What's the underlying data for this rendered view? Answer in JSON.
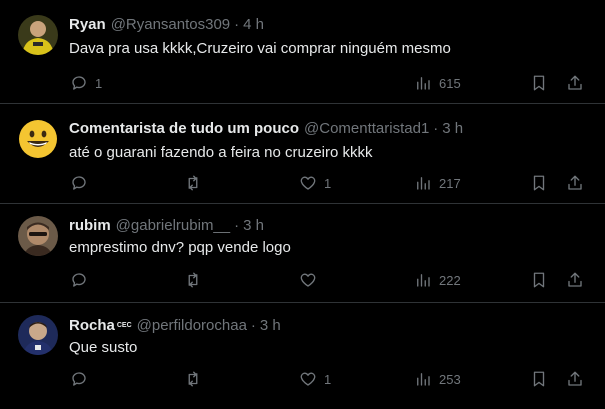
{
  "tweets": [
    {
      "name": "Ryan",
      "handle": "@Ryansantos309",
      "dot": "·",
      "time": "4 h",
      "text": "Dava pra usa kkkk,Cruzeiro vai comprar ninguém mesmo",
      "replies": "1",
      "retweets": "",
      "likes": "",
      "views": "615",
      "avatar_colors": [
        "#d8c21a",
        "#2a2a2a"
      ]
    },
    {
      "name": "Comentarista de tudo um pouco",
      "handle": "@Comenttaristad1",
      "dot": "·",
      "time": "3 h",
      "text": "até o guarani fazendo a feira no cruzeiro kkkk",
      "replies": "",
      "retweets": "",
      "likes": "1",
      "views": "217",
      "avatar_colors": [
        "#f4c531",
        "#3b2a12"
      ]
    },
    {
      "name": "rubim",
      "handle": "@gabrielrubim__",
      "dot": "·",
      "time": "3 h",
      "text": "emprestimo dnv? pqp vende logo",
      "replies": "",
      "retweets": "",
      "likes": "",
      "views": "222",
      "avatar_colors": [
        "#8a6a4f",
        "#3a2a20"
      ]
    },
    {
      "name": "Rocha",
      "badge": "CEC",
      "handle": "@perfildorochaa",
      "dot": "·",
      "time": "3 h",
      "text": "Que susto",
      "replies": "",
      "retweets": "",
      "likes": "1",
      "views": "253",
      "avatar_colors": [
        "#1e2a5a",
        "#c8a88a"
      ]
    }
  ],
  "icons": {
    "reply": "reply-icon",
    "retweet": "retweet-icon",
    "like": "heart-icon",
    "views": "views-icon",
    "bookmark": "bookmark-icon",
    "share": "share-icon"
  }
}
